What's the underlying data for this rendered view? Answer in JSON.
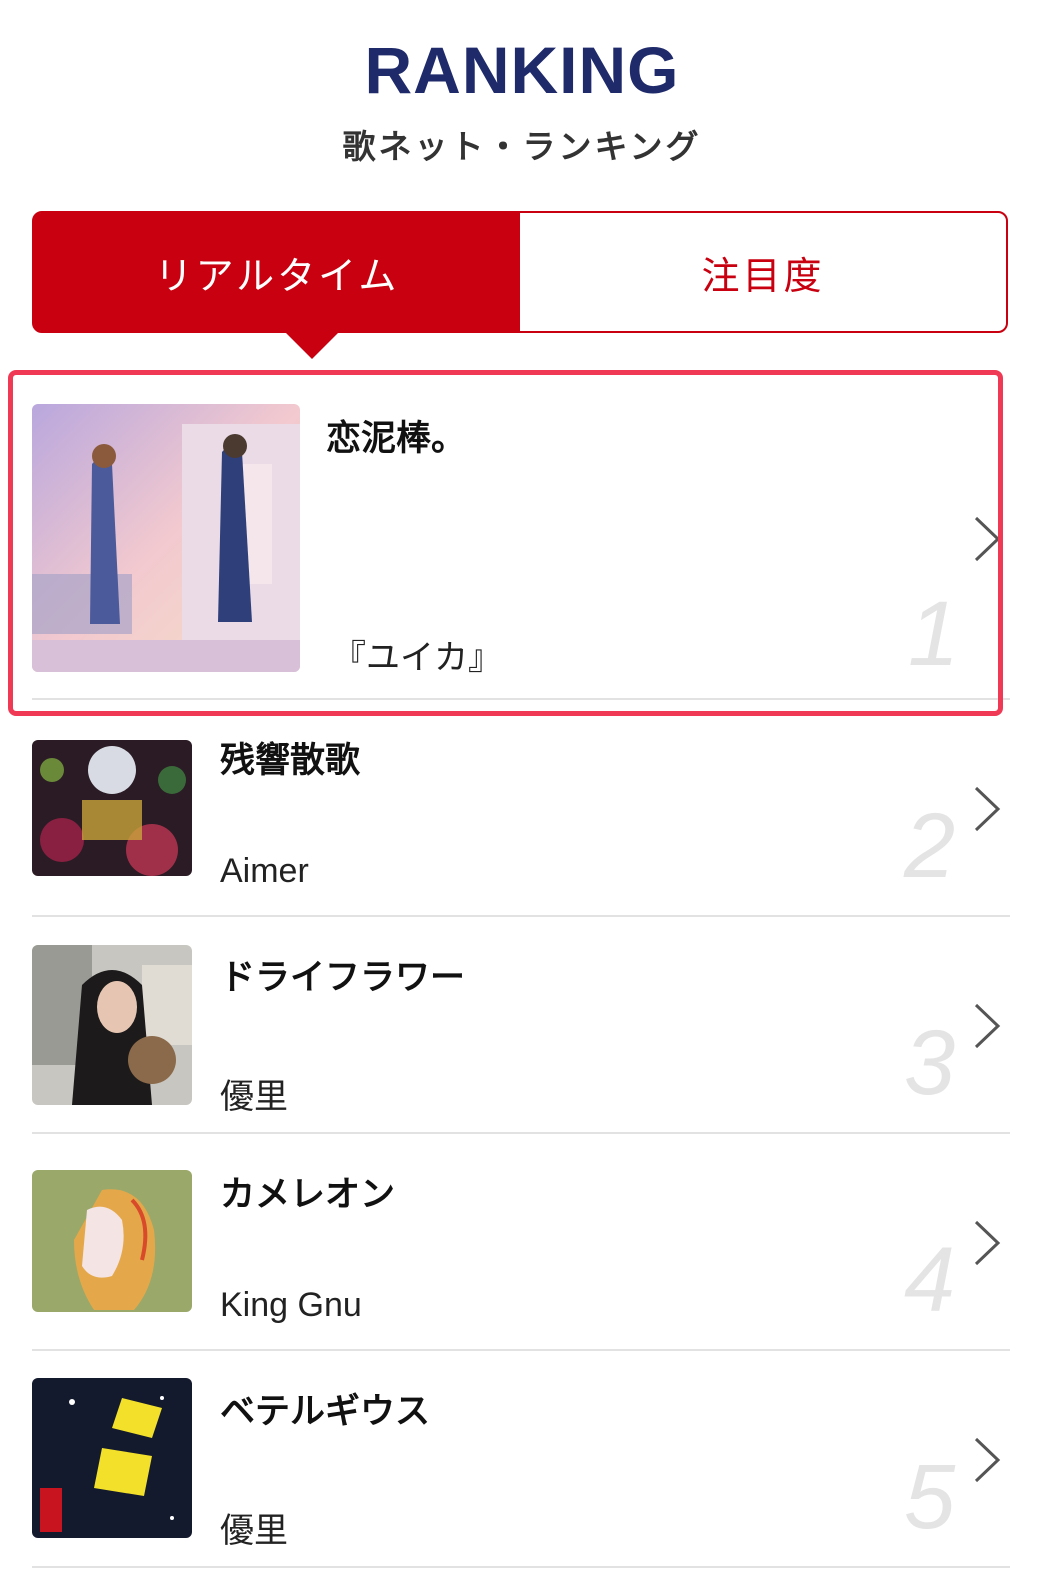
{
  "header": {
    "title": "RANKING",
    "subtitle": "歌ネット・ランキング"
  },
  "tabs": [
    {
      "label": "リアルタイム",
      "active": true
    },
    {
      "label": "注目度",
      "active": false
    }
  ],
  "ranking": [
    {
      "rank": "1",
      "song": "恋泥棒。",
      "artist": "『ユイカ』",
      "highlighted": true
    },
    {
      "rank": "2",
      "song": "残響散歌",
      "artist": "Aimer",
      "highlighted": false
    },
    {
      "rank": "3",
      "song": "ドライフラワー",
      "artist": "優里",
      "highlighted": false
    },
    {
      "rank": "4",
      "song": "カメレオン",
      "artist": "King Gnu",
      "highlighted": false
    },
    {
      "rank": "5",
      "song": "ベテルギウス",
      "artist": "優里",
      "highlighted": false
    }
  ],
  "colors": {
    "title": "#1f2a6b",
    "accent_red": "#c8000f",
    "highlight_border": "#f03a55",
    "rank_number": "#e4e4e4"
  },
  "icons": {
    "row_arrow": "chevron-right-icon"
  }
}
